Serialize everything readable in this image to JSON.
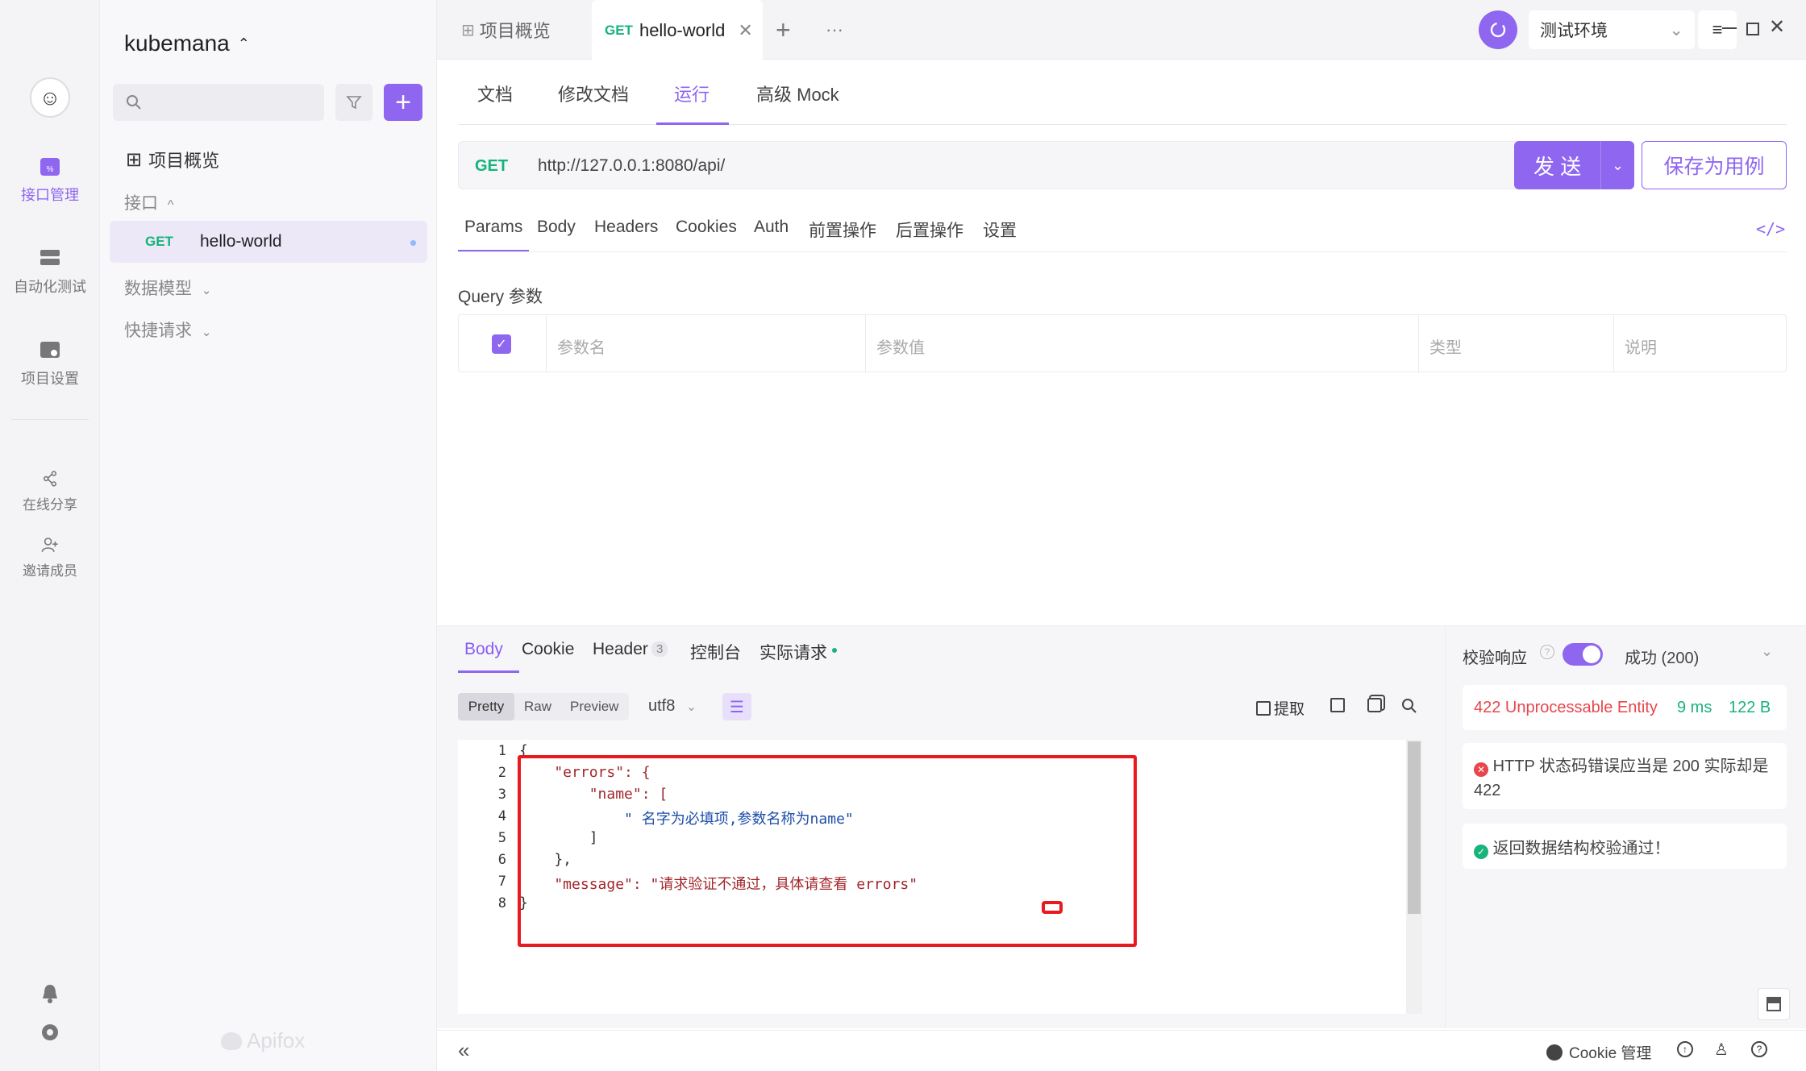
{
  "project": {
    "name": "kubemana"
  },
  "rail": {
    "items": [
      {
        "label": "接口管理"
      },
      {
        "label": "自动化测试"
      },
      {
        "label": "项目设置"
      },
      {
        "label": "在线分享"
      },
      {
        "label": "邀请成员"
      }
    ]
  },
  "sidebar": {
    "search_placeholder": "",
    "overview": "项目概览",
    "section_api": "接口",
    "api_item": {
      "method": "GET",
      "name": "hello-world"
    },
    "section_models": "数据模型",
    "section_quick": "快捷请求",
    "brand": "Apifox"
  },
  "tabs": {
    "overview": "项目概览",
    "active_method": "GET",
    "active_name": "hello-world",
    "more": "···"
  },
  "env": {
    "label": "测试环境"
  },
  "subtabs": [
    "文档",
    "修改文档",
    "运行",
    "高级 Mock"
  ],
  "request": {
    "method": "GET",
    "url": "http://127.0.0.1:8080/api/",
    "send": "发 送",
    "save": "保存为用例"
  },
  "param_tabs": [
    "Params",
    "Body",
    "Headers",
    "Cookies",
    "Auth",
    "前置操作",
    "后置操作",
    "设置"
  ],
  "query": {
    "title": "Query 参数",
    "columns": [
      "参数名",
      "参数值",
      "类型",
      "说明"
    ]
  },
  "response": {
    "tabs": [
      "Body",
      "Cookie",
      "Header",
      "控制台",
      "实际请求"
    ],
    "header_count": "3",
    "formats": [
      "Pretty",
      "Raw",
      "Preview"
    ],
    "encoding": "utf8",
    "extract": "提取",
    "code_lines": [
      "{",
      "    \"errors\": {",
      "        \"name\": [",
      "            \" 名字为必填项,参数名称为name\"",
      "        ]",
      "    },",
      "    \"message\": \"请求验证不通过，具体请查看 errors\"",
      "}"
    ],
    "line_numbers": [
      "1",
      "2",
      "3",
      "4",
      "5",
      "6",
      "7",
      "8"
    ]
  },
  "validation": {
    "label": "校验响应",
    "status_select": "成功 (200)",
    "status_text": "422 Unprocessable Entity",
    "time": "9 ms",
    "size": "122 B",
    "error_msg": "HTTP 状态码错误应当是 200 实际却是 422",
    "ok_msg": "返回数据结构校验通过！"
  },
  "statusbar": {
    "cookie": "Cookie 管理"
  },
  "colors": {
    "accent": "#8e66f0",
    "get": "#16b47a",
    "error": "#e8464c",
    "ok": "#19b37c"
  }
}
